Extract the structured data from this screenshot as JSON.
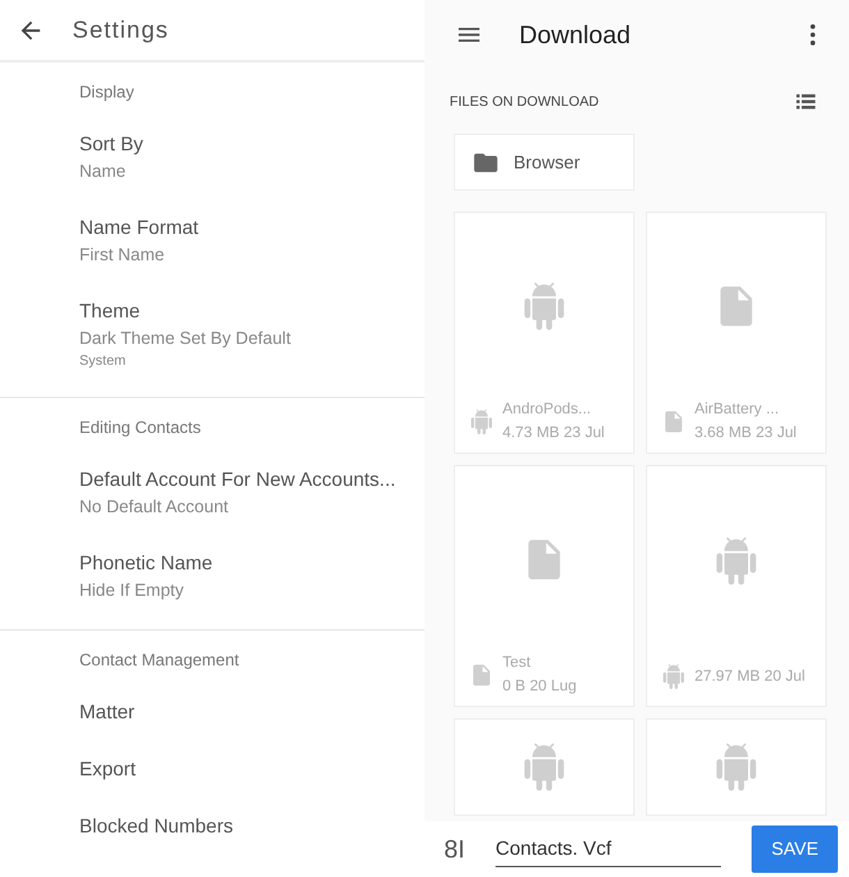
{
  "settings": {
    "title": "Settings",
    "sections": [
      {
        "heading": "Display",
        "items": [
          {
            "title": "Sort By",
            "subtitle": "Name"
          },
          {
            "title": "Name Format",
            "subtitle": "First Name"
          },
          {
            "title": "Theme",
            "subtitle": "Dark Theme Set By Default",
            "note": "System"
          }
        ]
      },
      {
        "heading": "Editing Contacts",
        "items": [
          {
            "title": "Default Account For New Accounts...",
            "subtitle": "No Default Account"
          },
          {
            "title": "Phonetic Name",
            "subtitle": "Hide If Empty"
          }
        ]
      },
      {
        "heading": "Contact Management",
        "items": [
          {
            "title": "Matter"
          },
          {
            "title": "Export"
          },
          {
            "title": "Blocked Numbers"
          }
        ]
      }
    ]
  },
  "downloads": {
    "title": "Download",
    "files_label": "FILES ON DOWNLOAD",
    "folders": [
      {
        "name": "Browser"
      }
    ],
    "files": [
      {
        "kind": "android",
        "name": "AndroPods...",
        "info": "4.73 MB 23 Jul"
      },
      {
        "kind": "document",
        "name": "AirBattery ...",
        "info": "3.68 MB 23 Jul"
      },
      {
        "kind": "document",
        "name": "Test",
        "info": "0 B 20 Lug"
      },
      {
        "kind": "android",
        "info": "27.97 MB 20 Jul"
      },
      {
        "kind": "android"
      },
      {
        "kind": "android"
      }
    ],
    "save_bar": {
      "label": "8I",
      "filename": "Contacts. Vcf",
      "button": "SAVE"
    }
  }
}
